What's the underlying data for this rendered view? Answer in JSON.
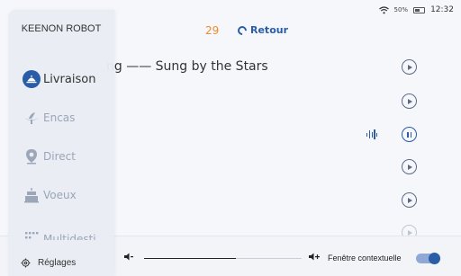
{
  "status": {
    "battery": "50%",
    "time": "12:32"
  },
  "countdown": "29",
  "back": {
    "label": "Retour"
  },
  "song": {
    "title": "ng —— Sung by the Stars"
  },
  "playlist_states": [
    "play",
    "play",
    "pause",
    "play",
    "play",
    "play"
  ],
  "sidebar": {
    "brand": "KEENON ROBOT",
    "items": [
      {
        "label": "Livraison",
        "icon": "delivery-icon"
      },
      {
        "label": "Encas",
        "icon": "snack-icon"
      },
      {
        "label": "Direct",
        "icon": "location-pin-icon"
      },
      {
        "label": "Voeux",
        "icon": "cake-icon"
      },
      {
        "label": "Multidesti",
        "icon": "grid-icon"
      }
    ],
    "settings_label": "Réglages"
  },
  "volume": {
    "level": 0.58
  },
  "popup": {
    "label": "Fenêtre contextuelle",
    "enabled": true
  },
  "colors": {
    "accent": "#2a5ca8",
    "countdown": "#f08a2b",
    "muted": "#9ba6b8"
  }
}
